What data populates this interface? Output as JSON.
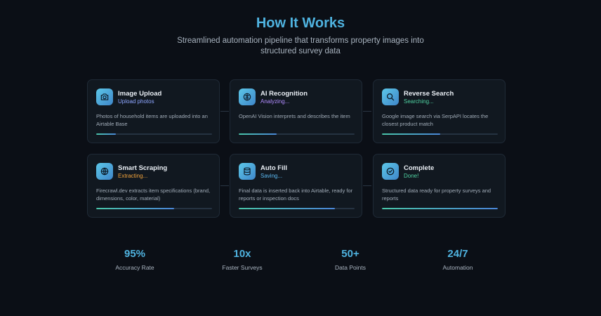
{
  "header": {
    "title": "How It Works",
    "subtitle": "Streamlined automation pipeline that transforms property images into structured survey data"
  },
  "steps": [
    {
      "title": "Image Upload",
      "status": "Upload photos",
      "status_color": "#8ea6ff",
      "description": "Photos of household items are uploaded into an Airtable Base",
      "progress": 0.17,
      "icon": "camera-icon"
    },
    {
      "title": "AI Recognition",
      "status": "Analyzing...",
      "status_color": "#b18cff",
      "description": "OpenAI Vision interprets and describes the item",
      "progress": 0.33,
      "icon": "brain-icon"
    },
    {
      "title": "Reverse Search",
      "status": "Searching...",
      "status_color": "#4fd1a1",
      "description": "Google image search via SerpAPI locates the closest product match",
      "progress": 0.5,
      "icon": "search-icon"
    },
    {
      "title": "Smart Scraping",
      "status": "Extracting...",
      "status_color": "#f0a23b",
      "description": "Firecrawl.dev extracts item specifications (brand, dimensions, color, material)",
      "progress": 0.67,
      "icon": "globe-icon"
    },
    {
      "title": "Auto Fill",
      "status": "Saving...",
      "status_color": "#5ab8f0",
      "description": "Final data is inserted back into Airtable, ready for reports or inspection docs",
      "progress": 0.83,
      "icon": "database-icon"
    },
    {
      "title": "Complete",
      "status": "Done!",
      "status_color": "#4fd1a1",
      "description": "Structured data ready for property surveys and reports",
      "progress": 1.0,
      "icon": "check-circle-icon"
    }
  ],
  "stats": [
    {
      "value": "95%",
      "label": "Accuracy Rate"
    },
    {
      "value": "10x",
      "label": "Faster Surveys"
    },
    {
      "value": "50+",
      "label": "Data Points"
    },
    {
      "value": "24/7",
      "label": "Automation"
    }
  ],
  "colors": {
    "accent": "#4fb3e0",
    "background": "#0b0f16",
    "card": "#111820"
  }
}
